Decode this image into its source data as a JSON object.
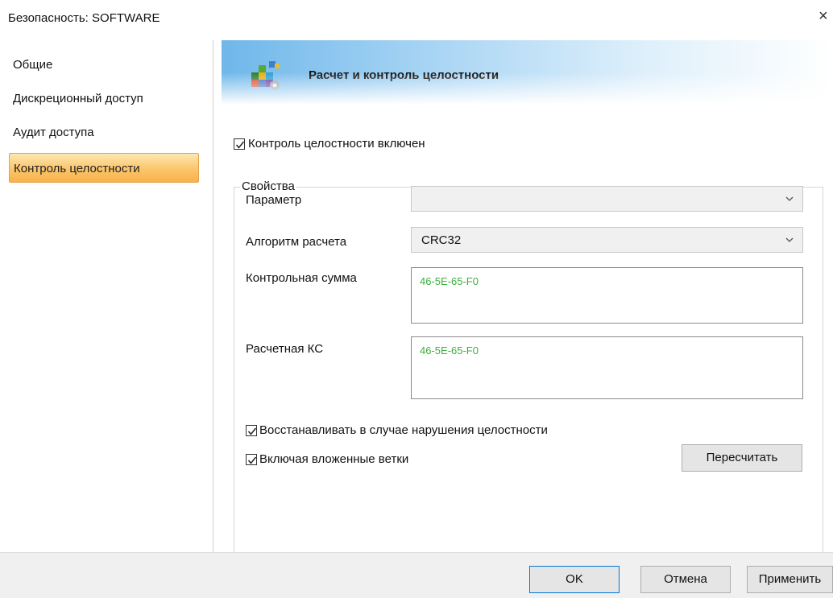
{
  "window": {
    "title": "Безопасность: SOFTWARE",
    "close_glyph": "×"
  },
  "sidebar": {
    "items": [
      {
        "label": "Общие"
      },
      {
        "label": "Дискреционный доступ"
      },
      {
        "label": "Аудит доступа"
      },
      {
        "label": "Контроль целостности",
        "active": true
      }
    ]
  },
  "header": {
    "title": "Расчет и контроль целостности",
    "icon": "integrity-blocks-icon"
  },
  "main": {
    "integrity_enabled": {
      "label": "Контроль целостности включен",
      "checked": true
    },
    "properties": {
      "legend": "Свойства",
      "parameter": {
        "label": "Параметр",
        "value": ""
      },
      "algorithm": {
        "label": "Алгоритм расчета",
        "value": "CRC32"
      },
      "checksum": {
        "label": "Контрольная сумма",
        "value": "46-5E-65-F0"
      },
      "calculated": {
        "label": "Расчетная КС",
        "value": "46-5E-65-F0"
      },
      "restore": {
        "label": "Восстанавливать в случае нарушения целостности",
        "checked": true
      },
      "include_nested": {
        "label": "Включая вложенные ветки",
        "checked": true
      },
      "recalc_button": "Пересчитать"
    }
  },
  "footer": {
    "ok": "OK",
    "cancel": "Отмена",
    "apply": "Применить"
  },
  "colors": {
    "checksum_text": "#3ab03a",
    "active_tab": "#fbc56a",
    "header_band": "#6fb7ea"
  }
}
